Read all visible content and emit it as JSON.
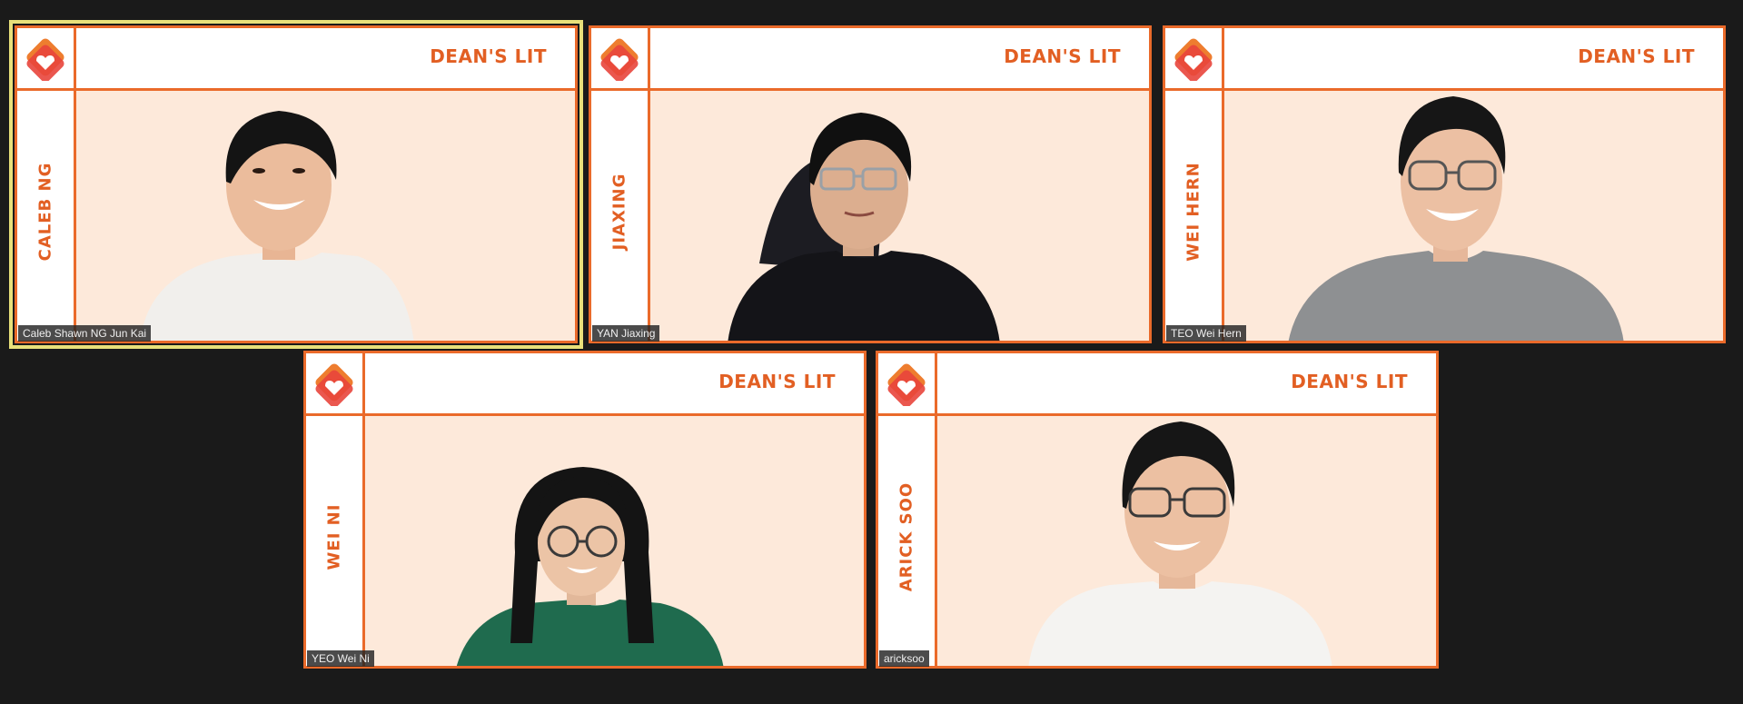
{
  "meeting": {
    "brand_label": "DEAN'S LIT",
    "theme": {
      "accent": "#ea6a2a",
      "accent_text": "#e25f23",
      "background": "#1a1a1a",
      "video_background": "#fde9da",
      "active_speaker_border": "#e8e07a"
    },
    "tiles": [
      {
        "side_name": "CALEB NG",
        "display_name": "Caleb Shawn NG Jun Kai",
        "active_speaker": true,
        "shirt_color": "#f1efec",
        "hair_color": "#141414",
        "glasses": false
      },
      {
        "side_name": "JIAXING",
        "display_name": "YAN Jiaxing",
        "active_speaker": false,
        "shirt_color": "#141418",
        "hair_color": "#101010",
        "glasses": true
      },
      {
        "side_name": "WEI HERN",
        "display_name": "TEO Wei Hern",
        "active_speaker": false,
        "shirt_color": "#8e9092",
        "hair_color": "#161616",
        "glasses": true
      },
      {
        "side_name": "WEI NI",
        "display_name": "YEO Wei Ni",
        "active_speaker": false,
        "shirt_color": "#1f6b4e",
        "hair_color": "#141414",
        "glasses": true
      },
      {
        "side_name": "ARICK SOO",
        "display_name": "aricksoo",
        "active_speaker": false,
        "shirt_color": "#f4f3f1",
        "hair_color": "#161616",
        "glasses": true
      }
    ]
  }
}
